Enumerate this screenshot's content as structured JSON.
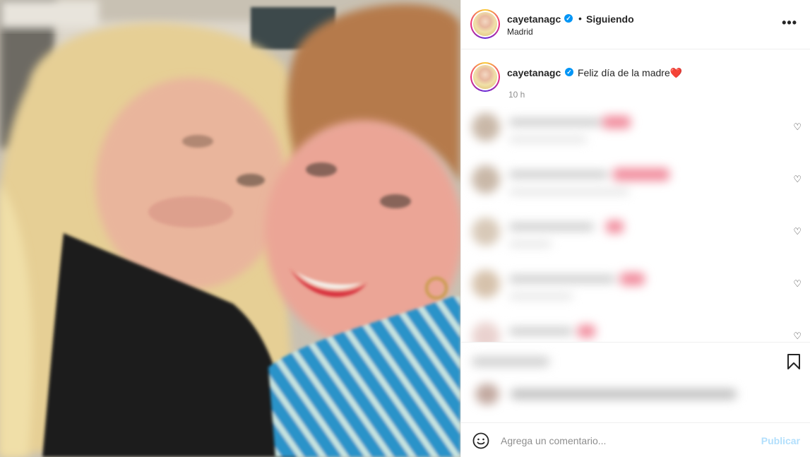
{
  "post": {
    "username": "cayetanagc",
    "verified_mark": "✓",
    "separator": "•",
    "follow_status": "Siguiendo",
    "location": "Madrid",
    "more_label": "•••",
    "caption_text": "Feliz día de la madre",
    "caption_emoji": "❤️",
    "posted_time": "10 h"
  },
  "comments": {
    "like_icon": "heart-outline-icon",
    "like_glyph": "♡"
  },
  "composer": {
    "placeholder": "Agrega un comentario...",
    "publish_label": "Publicar",
    "emoji_icon": "smiley-icon"
  },
  "actions": {
    "bookmark_icon": "bookmark-icon"
  },
  "colors": {
    "accent": "#0095f6",
    "publish_disabled": "#b2dffc",
    "caption_heart": "#e0245e"
  }
}
